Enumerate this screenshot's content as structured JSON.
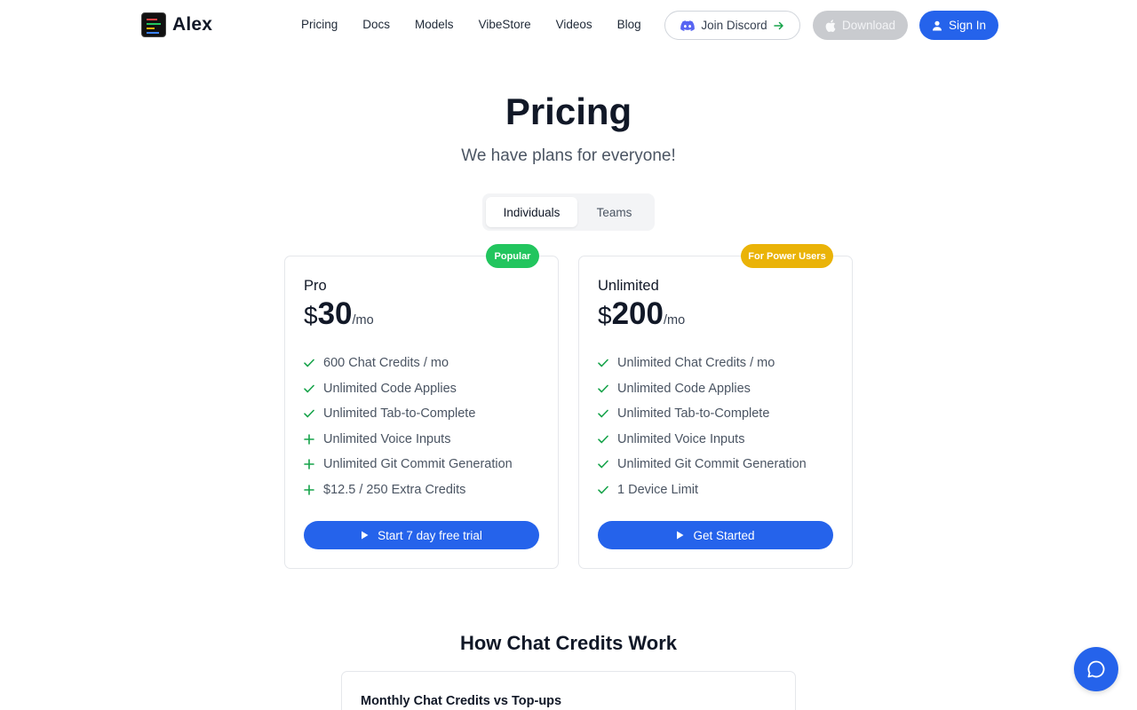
{
  "header": {
    "brand": "Alex",
    "nav": [
      "Pricing",
      "Docs",
      "Models",
      "VibeStore",
      "Videos",
      "Blog"
    ],
    "discord_label": "Join Discord",
    "download_label": "Download",
    "signin_label": "Sign In"
  },
  "hero": {
    "title": "Pricing",
    "subtitle": "We have plans for everyone!"
  },
  "plan_toggle": {
    "options": [
      "Individuals",
      "Teams"
    ],
    "selected": "Individuals"
  },
  "plans": [
    {
      "badge": "Popular",
      "name": "Pro",
      "currency": "$",
      "amount": "30",
      "period": "/mo",
      "features": [
        {
          "icon": "check-icon",
          "text": "600 Chat Credits / mo"
        },
        {
          "icon": "check-icon",
          "text": "Unlimited Code Applies"
        },
        {
          "icon": "check-icon",
          "text": "Unlimited Tab-to-Complete"
        },
        {
          "icon": "plus-icon",
          "text": "Unlimited Voice Inputs"
        },
        {
          "icon": "plus-icon",
          "text": "Unlimited Git Commit Generation"
        },
        {
          "icon": "plus-icon",
          "text": "$12.5 / 250 Extra Credits"
        }
      ],
      "cta": "Start 7 day free trial"
    },
    {
      "badge": "For Power Users",
      "name": "Unlimited",
      "currency": "$",
      "amount": "200",
      "period": "/mo",
      "features": [
        {
          "icon": "check-icon",
          "text": "Unlimited Chat Credits / mo"
        },
        {
          "icon": "check-icon",
          "text": "Unlimited Code Applies"
        },
        {
          "icon": "check-icon",
          "text": "Unlimited Tab-to-Complete"
        },
        {
          "icon": "check-icon",
          "text": "Unlimited Voice Inputs"
        },
        {
          "icon": "check-icon",
          "text": "Unlimited Git Commit Generation"
        },
        {
          "icon": "check-icon",
          "text": "1 Device Limit"
        }
      ],
      "cta": "Get Started"
    }
  ],
  "credits_section": {
    "title": "How Chat Credits Work",
    "card_title": "Monthly Chat Credits vs Top-ups"
  },
  "colors": {
    "accent": "#2563eb",
    "popular_badge": "#22c55e",
    "power_badge": "#eab308",
    "check": "#16a34a"
  }
}
